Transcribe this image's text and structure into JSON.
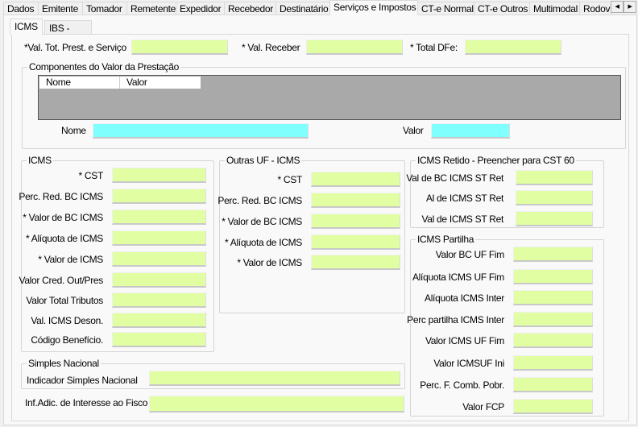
{
  "tabs": [
    "Dados",
    "Emitente",
    "Tomador",
    "Remetente",
    "Expedidor",
    "Recebedor",
    "Destinatário",
    "Serviços e Impostos",
    "CT-e Normal",
    "CT-e Outros",
    "Multimodal",
    "Rodov"
  ],
  "selected_tab": "Serviços e Impostos",
  "inner_tabs": [
    "ICMS",
    "IBS - CBS"
  ],
  "top": {
    "val_tot": "*Val. Tot. Prest. e Serviço",
    "val_receber": "* Val. Receber",
    "total_dfe": "* Total DFe:"
  },
  "componentes": {
    "title": "Componentes do Valor da Prestação",
    "columns": [
      "Nome",
      "Valor"
    ],
    "nome_label": "Nome",
    "valor_label": "Valor"
  },
  "icms": {
    "title": "ICMS",
    "labels": [
      "* CST",
      "Perc. Red. BC ICMS",
      "* Valor de BC ICMS",
      "* Alíquota de ICMS",
      "* Valor de ICMS",
      "Valor Cred. Out/Pres",
      "Valor Total Tributos",
      "Val. ICMS Deson.",
      "Código Benefício."
    ]
  },
  "outras": {
    "title": "Outras UF - ICMS",
    "labels": [
      "* CST",
      "Perc. Red. BC ICMS",
      "* Valor de BC ICMS",
      "* Alíquota de ICMS",
      "* Valor de ICMS"
    ]
  },
  "retido": {
    "title": "ICMS Retido - Preencher para CST 60",
    "labels": [
      "Val de BC ICMS ST Ret",
      "Al de ICMS ST Ret",
      "Val de ICMS ST Ret"
    ]
  },
  "partilha": {
    "title": "ICMS Partilha",
    "labels": [
      "Valor BC UF Fim",
      "Alíquota ICMS UF Fim",
      "Alíquota ICMS Inter",
      "Perc partilha ICMS Inter",
      "Valor ICMS UF Fim",
      "Valor ICMSUF Ini",
      "Perc. F. Comb. Pobr.",
      "Valor FCP"
    ]
  },
  "simples": {
    "title": "Simples Nacional",
    "label": "Indicador Simples Nacional"
  },
  "inf_adic": "Inf.Adic. de Interesse ao Fisco",
  "colors": {
    "field": "#e1ffa2",
    "field_alt": "#80ffff",
    "grid": "#a9a9a9"
  },
  "icons": {
    "scroll_left": "arrow-left-icon",
    "scroll_right": "arrow-right-icon"
  }
}
